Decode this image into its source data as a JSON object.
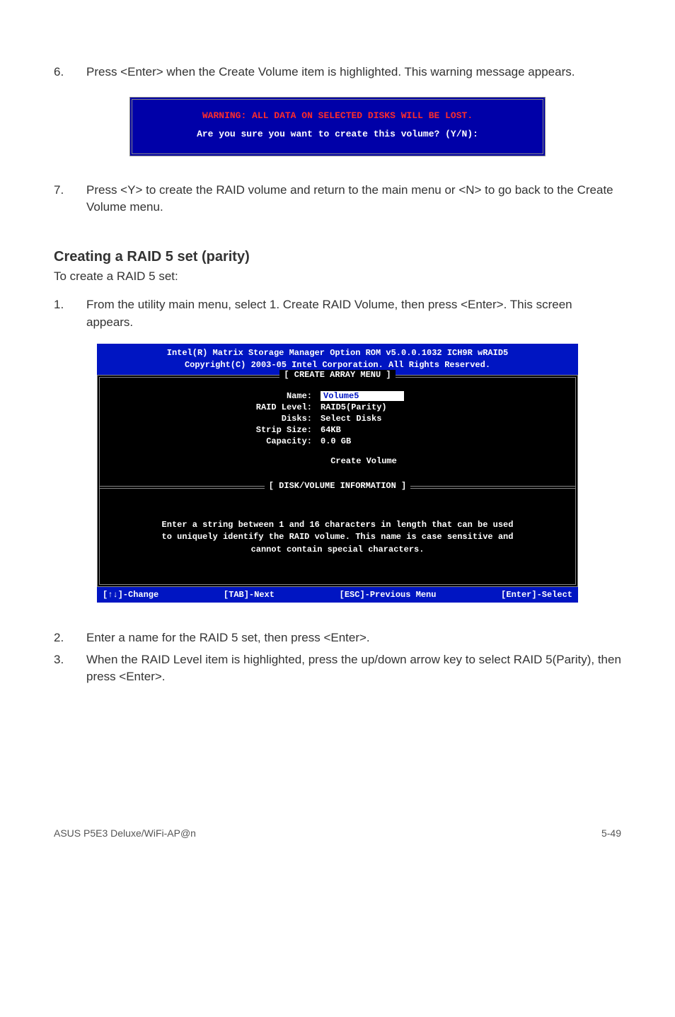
{
  "steps": {
    "s6": {
      "num": "6.",
      "text": "Press <Enter> when the Create Volume item is highlighted. This warning message appears."
    },
    "s7": {
      "num": "7.",
      "text": "Press <Y> to create the RAID volume and return to the main menu or <N> to go back to the Create Volume menu."
    },
    "s1": {
      "num": "1.",
      "text": "From the utility main menu, select 1. Create RAID Volume, then press <Enter>. This screen appears."
    },
    "s2": {
      "num": "2.",
      "text": "Enter a name for the RAID 5 set, then press <Enter>."
    },
    "s3": {
      "num": "3.",
      "text": "When the RAID Level item is highlighted, press the up/down arrow key to select RAID 5(Parity), then press <Enter>."
    }
  },
  "dialog": {
    "warn": "WARNING: ALL DATA ON SELECTED DISKS WILL BE LOST.",
    "confirm": "Are you sure you want to create this volume? (Y/N):"
  },
  "section": {
    "heading": "Creating a RAID 5 set (parity)",
    "intro": "To create a RAID 5 set:"
  },
  "bios": {
    "header1": "Intel(R) Matrix Storage Manager Option ROM v5.0.0.1032 ICH9R wRAID5",
    "header2": "Copyright(C) 2003-05 Intel Corporation. All Rights Reserved.",
    "panel1": "[ CREATE ARRAY MENU ]",
    "labels": {
      "name": "Name:",
      "raid": "RAID Level:",
      "disks": "Disks:",
      "strip": "Strip Size:",
      "cap": "Capacity:"
    },
    "values": {
      "name": "Volume5",
      "raid": "RAID5(Parity)",
      "disks": "Select Disks",
      "strip": "64KB",
      "cap": "0.0  GB"
    },
    "create": "Create Volume",
    "panel2": "[ DISK/VOLUME INFORMATION ]",
    "info1": "Enter a string between 1 and 16 characters in length that can be used",
    "info2": "to uniquely identify the RAID volume. This name is case sensitive and",
    "info3": "cannot contain special characters.",
    "footer": {
      "change": "[↑↓]-Change",
      "next": "[TAB]-Next",
      "prev": "[ESC]-Previous Menu",
      "select": "[Enter]-Select"
    }
  },
  "pagefooter": {
    "left": "ASUS P5E3 Deluxe/WiFi-AP@n",
    "right": "5-49"
  }
}
